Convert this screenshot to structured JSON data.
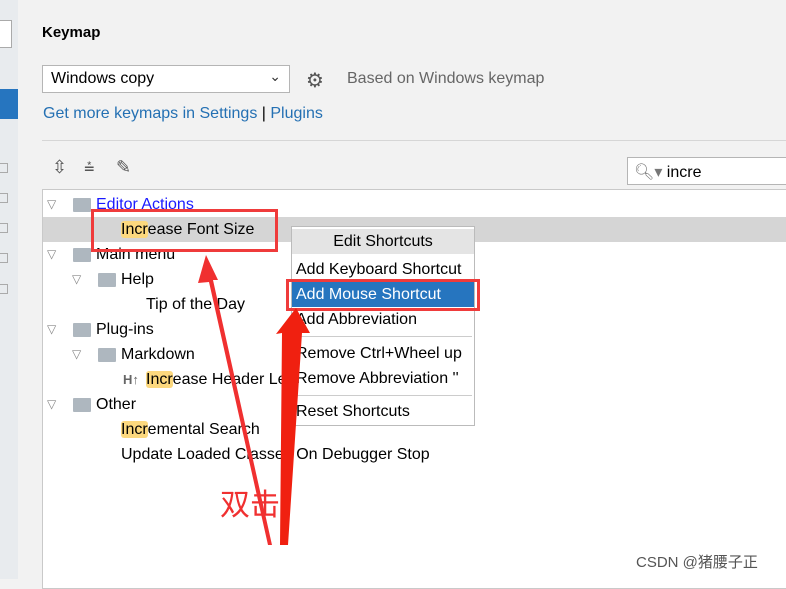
{
  "header": {
    "title": "Keymap",
    "keymap_select": "Windows copy",
    "based_on": "Based on Windows keymap",
    "link_settings": "Get more keymaps in Settings",
    "separator": "|",
    "link_plugins": "Plugins"
  },
  "search": {
    "value": "incre"
  },
  "toolbar": {
    "expand_icon": "expand-all-icon",
    "collapse_icon": "collapse-all-icon",
    "edit_icon": "pencil-icon"
  },
  "tree": {
    "editor_actions": "Editor Actions",
    "increase_font_hl": "Incr",
    "increase_font_rest": "ease Font Size",
    "main_menu": "Main menu",
    "help": "Help",
    "tip": "Tip of the Day",
    "plugins": "Plug-ins",
    "markdown": "Markdown",
    "ht_icon": "H↑",
    "header_hl": "Incr",
    "header_rest": "ease Header Le",
    "other": "Other",
    "incr_search_hl": "Incr",
    "incr_search_rest": "emental Search",
    "update_classes": "Update Loaded Classes On Debugger Stop"
  },
  "context_menu": {
    "title": "Edit Shortcuts",
    "items": [
      "Add Keyboard Shortcut",
      "Add Mouse Shortcut",
      "Add Abbreviation",
      "Remove Ctrl+Wheel up",
      "Remove Abbreviation ''",
      "Reset Shortcuts"
    ],
    "selected": "Add Mouse Shortcut"
  },
  "annotation": {
    "text": "双击",
    "color": "#f03030"
  },
  "watermark": "CSDN @猪腰子正",
  "colors": {
    "selection": "#2675bf",
    "link": "#2470b3",
    "highlight": "#fcd87e",
    "annotation": "#ef3b3b"
  }
}
